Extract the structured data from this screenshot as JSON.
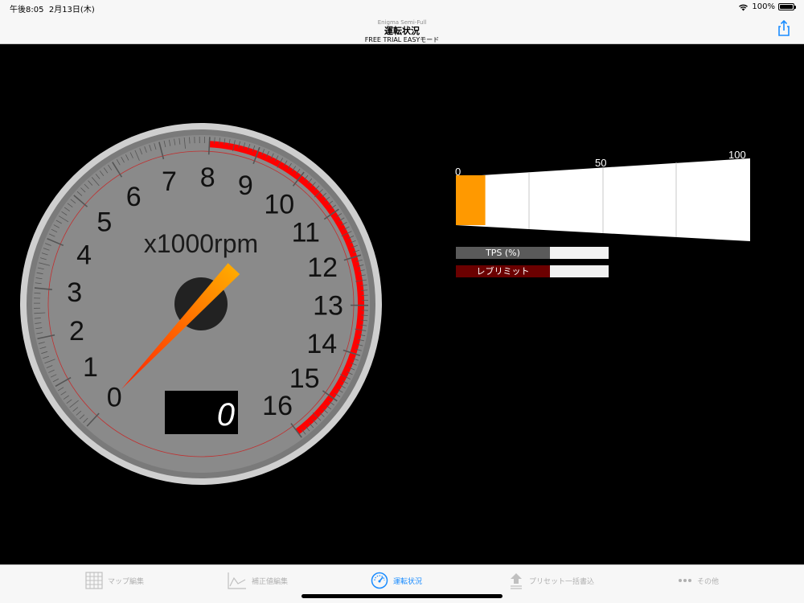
{
  "status_bar": {
    "time": "午後8:05",
    "date": "2月13日(木)",
    "battery": "100%"
  },
  "nav": {
    "subtitle": "Enigma Semi-Full",
    "title": "運転状況",
    "mode": "FREE TRIAL EASYモード",
    "share_icon": "share-icon"
  },
  "tachometer": {
    "unit_label": "x1000rpm",
    "tick_labels": [
      "0",
      "1",
      "2",
      "3",
      "4",
      "5",
      "6",
      "7",
      "8",
      "9",
      "10",
      "11",
      "12",
      "13",
      "14",
      "15",
      "16"
    ],
    "digital_readout": "0",
    "needle_value": 0,
    "redline_start": 8,
    "max": 16,
    "colors": {
      "redline": "#ff0000",
      "needle_start": "#ff2200",
      "needle_end": "#ffb000",
      "face": "#8a8a8a",
      "bezel": "#cfcfcf"
    }
  },
  "tps_bar": {
    "scale_labels": [
      "0",
      "50",
      "100"
    ],
    "fill_fraction": 0.1,
    "fill_color": "#ff9900"
  },
  "legend": [
    {
      "label": "TPS (%)",
      "color": "#5a5a5a"
    },
    {
      "label": "レブリミット",
      "color": "#6b0000"
    }
  ],
  "tabbar": {
    "tabs": [
      {
        "label": "マップ編集",
        "icon": "grid-icon",
        "active": false
      },
      {
        "label": "補正値編集",
        "icon": "line-chart-icon",
        "active": false
      },
      {
        "label": "運転状況",
        "icon": "speedometer-icon",
        "active": true
      },
      {
        "label": "プリセット一括書込",
        "icon": "upload-icon",
        "active": false
      },
      {
        "label": "その他",
        "icon": "more-icon",
        "active": false
      }
    ]
  }
}
